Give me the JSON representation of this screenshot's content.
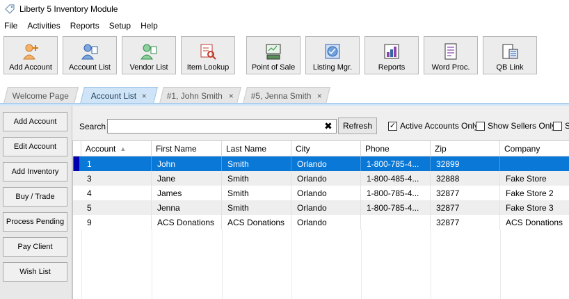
{
  "window": {
    "title": "Liberty 5 Inventory Module"
  },
  "menu": [
    "File",
    "Activities",
    "Reports",
    "Setup",
    "Help"
  ],
  "toolbar": [
    {
      "label": "Add Account",
      "icon": "add-account-icon"
    },
    {
      "label": "Account List",
      "icon": "account-list-icon"
    },
    {
      "label": "Vendor List",
      "icon": "vendor-list-icon"
    },
    {
      "label": "Item Lookup",
      "icon": "item-lookup-icon"
    },
    {
      "label": "Point of Sale",
      "icon": "point-of-sale-icon"
    },
    {
      "label": "Listing Mgr.",
      "icon": "listing-manager-icon"
    },
    {
      "label": "Reports",
      "icon": "reports-icon"
    },
    {
      "label": "Word Proc.",
      "icon": "word-processor-icon"
    },
    {
      "label": "QB Link",
      "icon": "quickbooks-link-icon"
    }
  ],
  "tabs": [
    {
      "label": "Welcome Page",
      "closable": false,
      "active": false
    },
    {
      "label": "Account List",
      "closable": true,
      "active": true
    },
    {
      "label": "#1, John Smith",
      "closable": true,
      "active": false
    },
    {
      "label": "#5, Jenna Smith",
      "closable": true,
      "active": false
    }
  ],
  "sidebar": [
    "Add Account",
    "Edit Account",
    "Add Inventory",
    "Buy / Trade",
    "Process Pending",
    "Pay Client",
    "Wish List"
  ],
  "search": {
    "label": "Search",
    "value": "",
    "clear_glyph": "✖",
    "refresh_label": "Refresh",
    "filters": [
      {
        "label": "Active Accounts Only",
        "checked": true
      },
      {
        "label": "Show Sellers Only",
        "checked": false
      },
      {
        "label": "Sh",
        "checked": false
      }
    ]
  },
  "table": {
    "columns": [
      "Account",
      "First Name",
      "Last Name",
      "City",
      "Phone",
      "Zip",
      "Company"
    ],
    "sort_column": "Account",
    "rows": [
      {
        "Account": "1",
        "First Name": "John",
        "Last Name": "Smith",
        "City": "Orlando",
        "Phone": "1-800-785-4...",
        "Zip": "32899",
        "Company": ""
      },
      {
        "Account": "3",
        "First Name": "Jane",
        "Last Name": "Smith",
        "City": "Orlando",
        "Phone": "1-800-485-4...",
        "Zip": "32888",
        "Company": "Fake Store"
      },
      {
        "Account": "4",
        "First Name": "James",
        "Last Name": "Smith",
        "City": "Orlando",
        "Phone": "1-800-785-4...",
        "Zip": "32877",
        "Company": "Fake Store 2"
      },
      {
        "Account": "5",
        "First Name": "Jenna",
        "Last Name": "Smith",
        "City": "Orlando",
        "Phone": "1-800-785-4...",
        "Zip": "32877",
        "Company": "Fake Store 3"
      },
      {
        "Account": "9",
        "First Name": "ACS Donations",
        "Last Name": "ACS Donations",
        "City": "Orlando",
        "Phone": "",
        "Zip": "32877",
        "Company": "ACS Donations"
      }
    ],
    "selected_row": 0
  },
  "colors": {
    "accent": "#0a78d7",
    "tab_active": "#cfe5f7",
    "row_marker": "#0000b0"
  }
}
